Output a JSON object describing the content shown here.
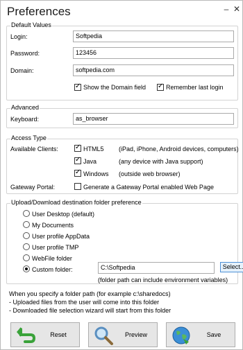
{
  "window": {
    "title": "Preferences",
    "minimize_glyph": "–",
    "close_glyph": "✕"
  },
  "default_values": {
    "legend": "Default Values",
    "login_label": "Login:",
    "login_value": "Softpedia",
    "password_label": "Password:",
    "password_value": "123456",
    "domain_label": "Domain:",
    "domain_value": "softpedia.com",
    "show_domain_label": "Show the Domain field",
    "show_domain_checked": true,
    "remember_login_label": "Remember last login",
    "remember_login_checked": true
  },
  "advanced": {
    "legend": "Advanced",
    "keyboard_label": "Keyboard:",
    "keyboard_value": "as_browser"
  },
  "access_type": {
    "legend": "Access Type",
    "available_clients_label": "Available Clients:",
    "clients": [
      {
        "name": "HTML5",
        "desc": "(iPad, iPhone, Android devices, computers)",
        "checked": true
      },
      {
        "name": "Java",
        "desc": "(any device with Java support)",
        "checked": true
      },
      {
        "name": "Windows",
        "desc": "(outside web browser)",
        "checked": true
      }
    ],
    "gateway_portal_label": "Gateway Portal:",
    "gateway_portal_option": "Generate a Gateway Portal enabled Web Page",
    "gateway_portal_checked": false
  },
  "upload": {
    "legend": "Upload/Download destination folder preference",
    "options": [
      {
        "label": "User Desktop (default)",
        "checked": false
      },
      {
        "label": "My Documents",
        "checked": false
      },
      {
        "label": "User profile AppData",
        "checked": false
      },
      {
        "label": "User profile TMP",
        "checked": false
      },
      {
        "label": "WebFile folder",
        "checked": false
      },
      {
        "label": "Custom folder:",
        "checked": true
      }
    ],
    "custom_folder_value": "C:\\Softpedia",
    "select_button": "Select...",
    "env_note": "(folder path can include environment variables)"
  },
  "info_text": {
    "line1": "When you specify a folder path (for example c:\\sharedocs)",
    "line2": " - Uploaded files from the user will come into this folder",
    "line3": " - Downloaded file selection wizard will start from this folder"
  },
  "buttons": {
    "reset": "Reset",
    "preview": "Preview",
    "save": "Save"
  },
  "icons": {
    "reset": "arrow-undo-icon",
    "preview": "magnifier-icon",
    "save": "globe-icon"
  },
  "colors": {
    "focus_blue": "#4c8fd6",
    "reset_green": "#3aa23a",
    "group_border": "#d3d3d3"
  }
}
